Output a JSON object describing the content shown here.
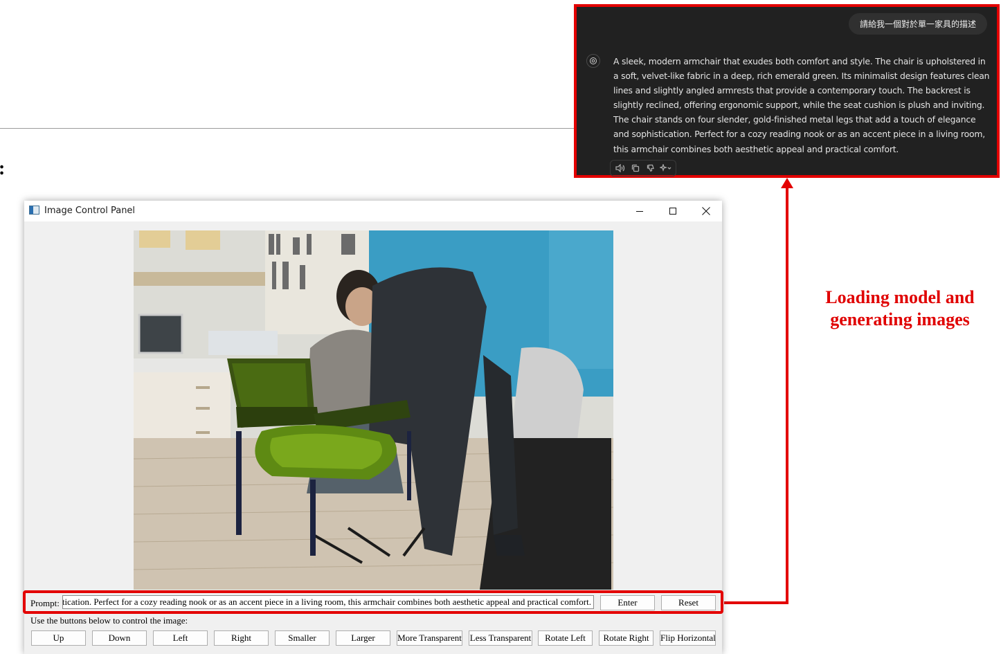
{
  "chat": {
    "user_message": "請給我一個對於單一家具的描述",
    "assistant_message": "A sleek, modern armchair that exudes both comfort and style. The chair is upholstered in a soft, velvet-like fabric in a deep, rich emerald green. Its minimalist design features clean lines and slightly angled armrests that provide a contemporary touch. The backrest is slightly reclined, offering ergonomic support, while the seat cushion is plush and inviting. The chair stands on four slender, gold-finished metal legs that add a touch of elegance and sophistication. Perfect for a cozy reading nook or as an accent piece in a living room, this armchair combines both aesthetic appeal and practical comfort.",
    "actions": [
      "speaker-icon",
      "copy-icon",
      "thumbs-down-icon",
      "sparkle-icon"
    ]
  },
  "left_mark": ":",
  "annotation": {
    "line1": "Loading model and",
    "line2": "generating images"
  },
  "window": {
    "title": "Image Control Panel"
  },
  "prompt": {
    "label": "Prompt:",
    "value": "ophistication. Perfect for a cozy reading nook or as an accent piece in a living room, this armchair combines both aesthetic appeal and practical comfort.",
    "enter": "Enter",
    "reset": "Reset"
  },
  "controls": {
    "hint": "Use the buttons below to control the image:",
    "up": "Up",
    "down": "Down",
    "left": "Left",
    "right": "Right",
    "smaller": "Smaller",
    "larger": "Larger",
    "more_transparent": "More Transparent",
    "less_transparent": "Less Transparent",
    "rotate_left": "Rotate Left",
    "rotate_right": "Rotate Right",
    "flip_horizontal": "Flip Horizontal"
  },
  "colors": {
    "accent_red": "#e30000",
    "chat_bg": "#212121",
    "chair_green": "#4a6b12"
  }
}
